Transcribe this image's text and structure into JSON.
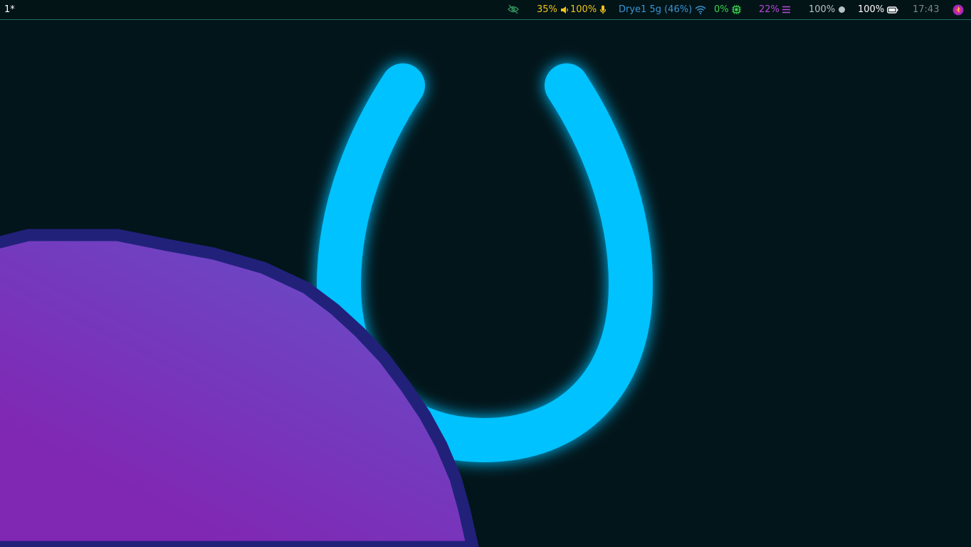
{
  "bar": {
    "workspace": "1*",
    "idle_inhibitor": {
      "icon": "eye-off-icon",
      "color": "#2e8b57"
    },
    "volume": {
      "value": "35%",
      "icon": "speaker-icon",
      "color": "#f0c419"
    },
    "mic": {
      "value": "100%",
      "icon": "microphone-icon",
      "color": "#f0c419"
    },
    "network": {
      "value": "Drye1 5g (46%)",
      "icon": "wifi-icon",
      "color": "#3a95d6"
    },
    "cpu": {
      "value": "0%",
      "icon": "cpu-chip-icon",
      "color": "#3ad24b"
    },
    "memory": {
      "value": "22%",
      "icon": "memory-bars-icon",
      "color": "#b54ad6"
    },
    "backlight": {
      "value": "100%",
      "icon": "brightness-dot-icon",
      "color": "#b8c2c6"
    },
    "battery": {
      "value": "100%",
      "icon": "battery-icon",
      "color": "#ffffff"
    },
    "clock": {
      "value": "17:43",
      "color": "#7a8488"
    },
    "notifications": {
      "icon": "notification-app-icon"
    }
  },
  "wallpaper": {
    "horseshoe_color": "#00c2ff",
    "blob_color_dark": "#8027b3",
    "blob_color_light": "#6a4ac6",
    "blob_outline": "#21217a"
  }
}
